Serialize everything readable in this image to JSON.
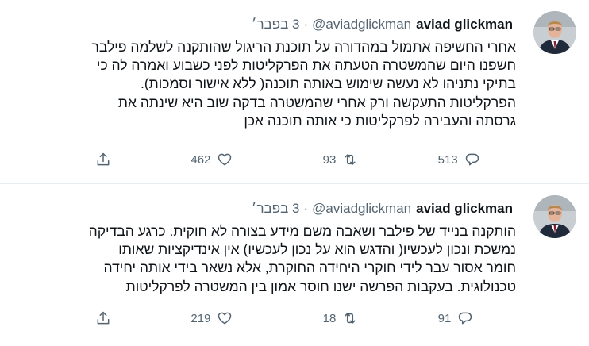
{
  "tweets": [
    {
      "author_name": "aviad glickman",
      "author_handle": "@aviadglickman",
      "separator": "·",
      "time": "3 בפבר׳",
      "text_lines": [
        "אחרי החשיפה אתמול במהדורה על תוכנת הריגול שהותקנה לשלמה פילבר",
        "חשפנו היום שהמשטרה הטעתה את הפרקליטות לפני כשבוע ואמרה לה כי",
        "בתיקי נתניהו לא נעשה שימוש באותה תוכנה( ללא אישור וסמכות).",
        "הפרקליטות התעקשה ורק אחרי שהמשטרה בדקה שוב היא שינתה את",
        "גרסתה והעבירה לפרקליטות כי אותה תוכנה אכן"
      ],
      "replies": "513",
      "retweets": "93",
      "likes": "462"
    },
    {
      "author_name": "aviad glickman",
      "author_handle": "@aviadglickman",
      "separator": "·",
      "time": "3 בפבר׳",
      "text_lines": [
        "הותקנה בנייד של פילבר ושאבה משם מידע בצורה לא חוקית. כרגע הבדיקה",
        "נמשכת ונכון לעכשיו( והדגש הוא על נכון לעכשיו) אין אינדיקציות שאותו",
        "חומר אסור עבר לידי חוקרי היחידה החוקרת, אלא נשאר בידי אותה יחידה",
        "טכנולוגית. בעקבות הפרשה ישנו חוסר אמון  בין המשטרה לפרקליטות"
      ],
      "replies": "91",
      "retweets": "18",
      "likes": "219"
    }
  ],
  "colors": {
    "text": "#0f1419",
    "muted": "#536471",
    "divider": "#e6ecf0"
  },
  "icons": [
    "reply-icon",
    "retweet-icon",
    "like-icon",
    "share-icon"
  ]
}
